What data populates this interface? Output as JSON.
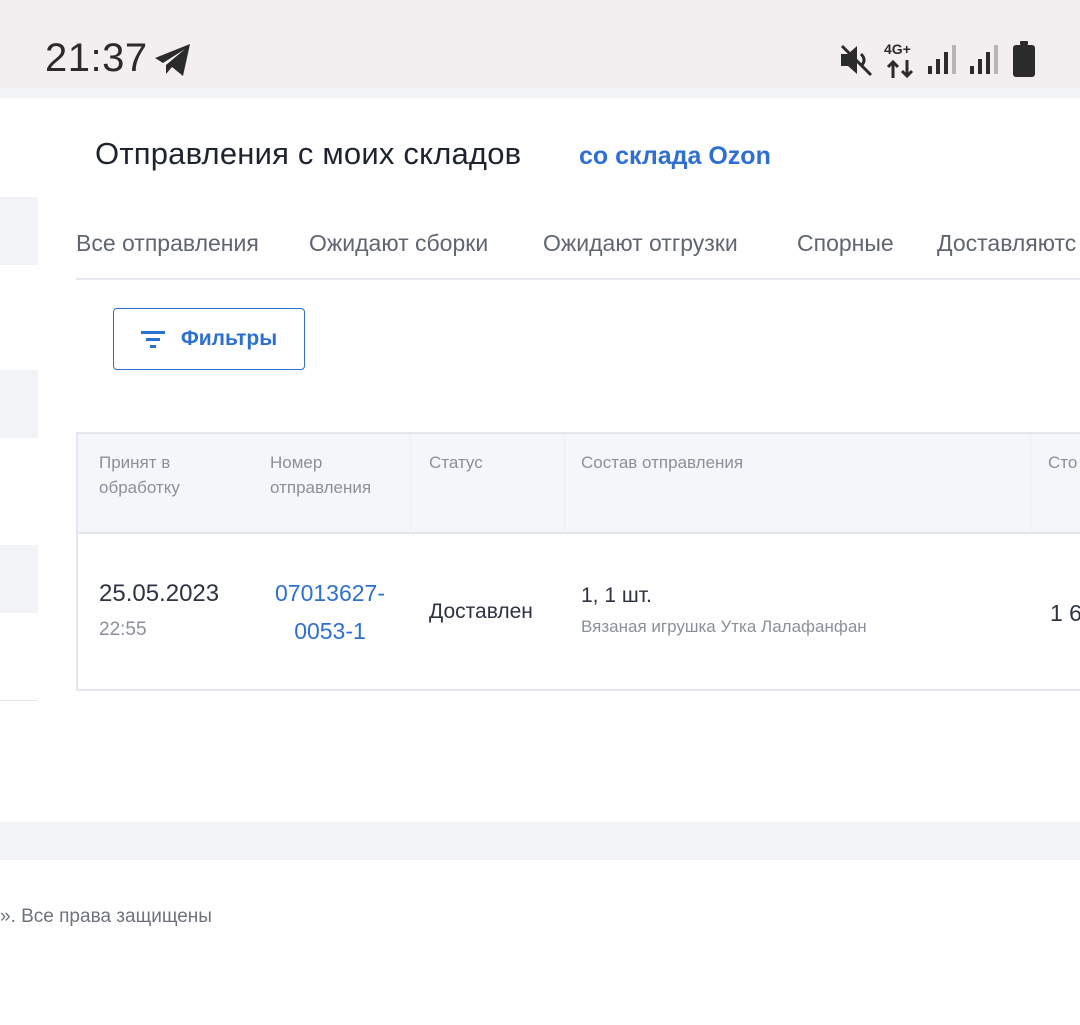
{
  "status_bar": {
    "time": "21:37",
    "network_label": "4G+",
    "icons": [
      "telegram-icon",
      "mute-icon",
      "network-icon",
      "signal-icon",
      "signal-icon",
      "battery-icon"
    ]
  },
  "header": {
    "title": "Отправления с моих складов",
    "alt_link": "со склада Ozon"
  },
  "tabs": [
    {
      "label": "Все отправления"
    },
    {
      "label": "Ожидают сборки"
    },
    {
      "label": "Ожидают отгрузки"
    },
    {
      "label": "Спорные"
    },
    {
      "label": "Доставляютс"
    }
  ],
  "filters": {
    "label": "Фильтры",
    "icon": "filter-icon"
  },
  "table": {
    "columns": [
      {
        "line1": "Принят в",
        "line2": "обработку"
      },
      {
        "line1": "Номер",
        "line2": "отправления"
      },
      {
        "line1": "Статус",
        "line2": ""
      },
      {
        "line1": "Состав отправления",
        "line2": ""
      },
      {
        "line1": "Сто",
        "line2": ""
      }
    ],
    "rows": [
      {
        "date": "25.05.2023",
        "time": "22:55",
        "number_line1": "07013627-",
        "number_line2": "0053-1",
        "status": "Доставлен",
        "quantity": "1, 1 шт.",
        "item": "Вязаная игрушка Утка Лалафанфан",
        "cost": "1 6"
      }
    ]
  },
  "footer": {
    "copyright": "». Все права защищены"
  },
  "colors": {
    "accent": "#2d6fd2",
    "text": "#1d2430",
    "muted": "#8a9099",
    "panel": "#f2f3f7"
  }
}
